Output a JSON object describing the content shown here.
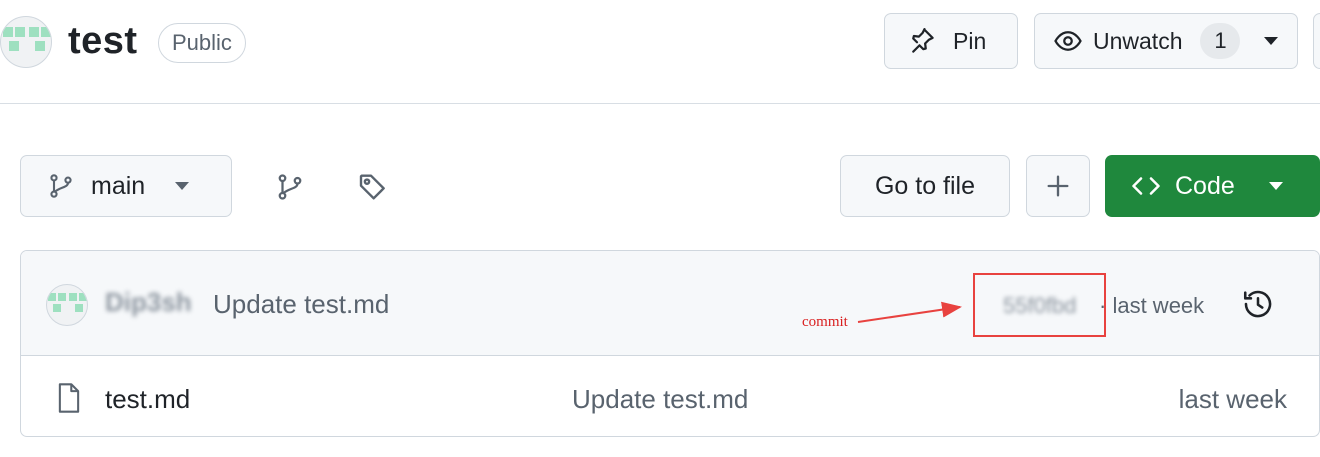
{
  "repo": {
    "name": "test",
    "visibility": "Public"
  },
  "header_actions": {
    "pin_label": "Pin",
    "unwatch_label": "Unwatch",
    "watch_count": "1"
  },
  "toolbar": {
    "branch": "main",
    "goto_file_label": "Go to file",
    "code_label": "Code",
    "add_icon": "plus-icon",
    "branches_icon": "git-branch-icon",
    "tags_icon": "tag-icon"
  },
  "latest_commit": {
    "author": "Dip3sh",
    "message": "Update test.md",
    "hash": "55f0fbd",
    "separator": "·",
    "time": "last week"
  },
  "files": [
    {
      "name": "test.md",
      "message": "Update test.md",
      "time": "last week"
    }
  ],
  "annotation": {
    "label": "commit",
    "color": "#e8423f"
  },
  "colors": {
    "primary_button": "#1f883d",
    "identicon": "#9ee0c0"
  }
}
